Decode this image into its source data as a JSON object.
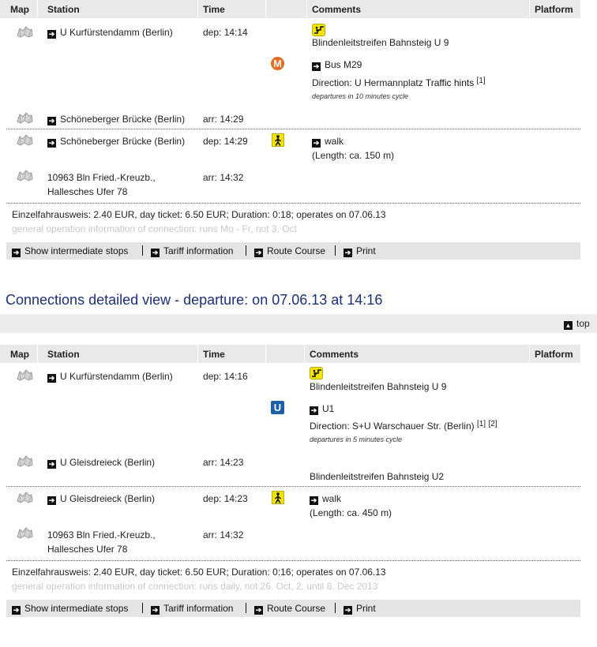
{
  "headers": {
    "map": "Map",
    "station": "Station",
    "time": "Time",
    "comments": "Comments",
    "platform": "Platform"
  },
  "conn1": {
    "stops": [
      {
        "station": "U Kurfürstendamm (Berlin)",
        "time": "dep: 14:14"
      },
      {
        "station": "Schöneberger Brücke (Berlin)",
        "time": "arr: 14:29"
      },
      {
        "station": "Schöneberger Brücke (Berlin)",
        "time": "dep: 14:29"
      },
      {
        "station_line1": "10963 Bln Fried.-Kreuzb.,",
        "station_line2": "Hallesches Ufer 78",
        "time": "arr: 14:32"
      }
    ],
    "comment_platform": "Blindenleitstreifen Bahnsteig U 9",
    "line": "Bus M29",
    "direction": "Direction: U Hermannplatz",
    "traffic_hints": "Traffic hints",
    "ref1": "[1]",
    "cycle": "departures in 10 minutes cycle",
    "walk": "walk",
    "walk_length": "(Length: ca. 150 m)",
    "fare": "Einzelfahrausweis: 2.40 EUR, day ticket: 6.50 EUR; Duration: 0:18; operates on 07.06.13",
    "general": "general operation information of connection: runs Mo - Fr, not 3. Oct"
  },
  "actions": {
    "intermediate": "Show intermediate stops",
    "tariff": "Tariff information",
    "route": "Route Course",
    "print": "Print"
  },
  "section_title": "Connections detailed view - departure: on 07.06.13 at 14:16",
  "top_link": "top",
  "conn2": {
    "stops": [
      {
        "station": "U Kurfürstendamm (Berlin)",
        "time": "dep: 14:16"
      },
      {
        "station": "U Gleisdreieck (Berlin)",
        "time": "arr: 14:23"
      },
      {
        "station": "U Gleisdreieck (Berlin)",
        "time": "dep: 14:23"
      },
      {
        "station_line1": "10963 Bln Fried.-Kreuzb.,",
        "station_line2": "Hallesches Ufer 78",
        "time": "arr: 14:32"
      }
    ],
    "comment_platform": "Blindenleitstreifen Bahnsteig U 9",
    "line": "U1",
    "direction": "Direction: S+U Warschauer Str. (Berlin)",
    "ref1": "[1]",
    "ref2": "[2]",
    "cycle": "departures in 5 minutes cycle",
    "arr_platform": "Blindenleitstreifen Bahnsteig U2",
    "walk": "walk",
    "walk_length": "(Length: ca. 450 m)",
    "fare": "Einzelfahrausweis: 2.40 EUR, day ticket: 6.50 EUR; Duration: 0:16; operates on 07.06.13",
    "general": "general operation information of connection: runs daily, not 26. Oct, 2. until 8. Dec 2013"
  },
  "colors": {
    "title": "#1c2f7a",
    "header_bg": "#e9e9e9",
    "metro": "#e86a1a",
    "ubahn": "#1b5fa8",
    "accessibility": "#f2e400"
  }
}
